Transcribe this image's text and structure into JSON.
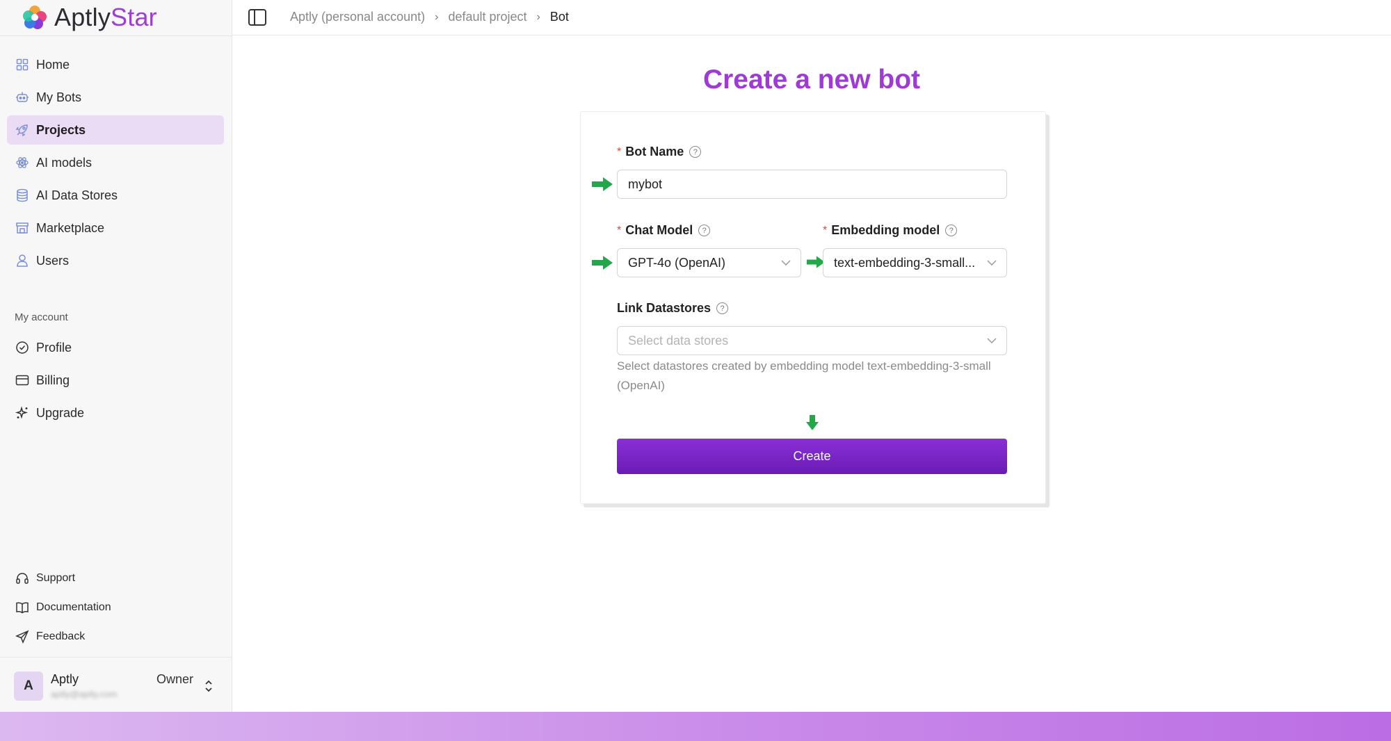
{
  "app": {
    "logo_prefix": "Aptly",
    "logo_suffix": "Star"
  },
  "sidebar": {
    "items": [
      {
        "label": "Home",
        "icon": "home-grid-icon"
      },
      {
        "label": "My Bots",
        "icon": "robot-icon"
      },
      {
        "label": "Projects",
        "icon": "rocket-icon",
        "active": true
      },
      {
        "label": "AI models",
        "icon": "atom-icon"
      },
      {
        "label": "AI Data Stores",
        "icon": "database-icon"
      },
      {
        "label": "Marketplace",
        "icon": "store-icon"
      },
      {
        "label": "Users",
        "icon": "user-icon"
      }
    ],
    "section_label": "My account",
    "account_items": [
      {
        "label": "Profile",
        "icon": "check-circle-icon"
      },
      {
        "label": "Billing",
        "icon": "credit-card-icon"
      },
      {
        "label": "Upgrade",
        "icon": "sparkle-icon"
      }
    ],
    "bottom_links": [
      {
        "label": "Support",
        "icon": "headset-icon"
      },
      {
        "label": "Documentation",
        "icon": "book-icon"
      },
      {
        "label": "Feedback",
        "icon": "send-icon"
      }
    ],
    "account": {
      "initial": "A",
      "name": "Aptly",
      "email": "aptly@aptly.com",
      "role": "Owner"
    }
  },
  "breadcrumb": [
    {
      "label": "Aptly (personal account)"
    },
    {
      "label": "default project"
    },
    {
      "label": "Bot"
    }
  ],
  "page": {
    "title": "Create a new bot"
  },
  "form": {
    "bot_name": {
      "label": "Bot Name",
      "value": "mybot"
    },
    "chat_model": {
      "label": "Chat Model",
      "value": "GPT-4o (OpenAI)"
    },
    "embedding_model": {
      "label": "Embedding model",
      "value": "text-embedding-3-small..."
    },
    "datastores": {
      "label": "Link Datastores",
      "placeholder": "Select data stores",
      "hint": "Select datastores created by embedding model text-embedding-3-small (OpenAI)"
    },
    "submit_label": "Create"
  },
  "colors": {
    "accent": "#a03ad6",
    "button": "#7b25c8",
    "active_nav": "#ebdcf6",
    "annotation_arrow": "#22a84a",
    "required": "#e0443d"
  }
}
